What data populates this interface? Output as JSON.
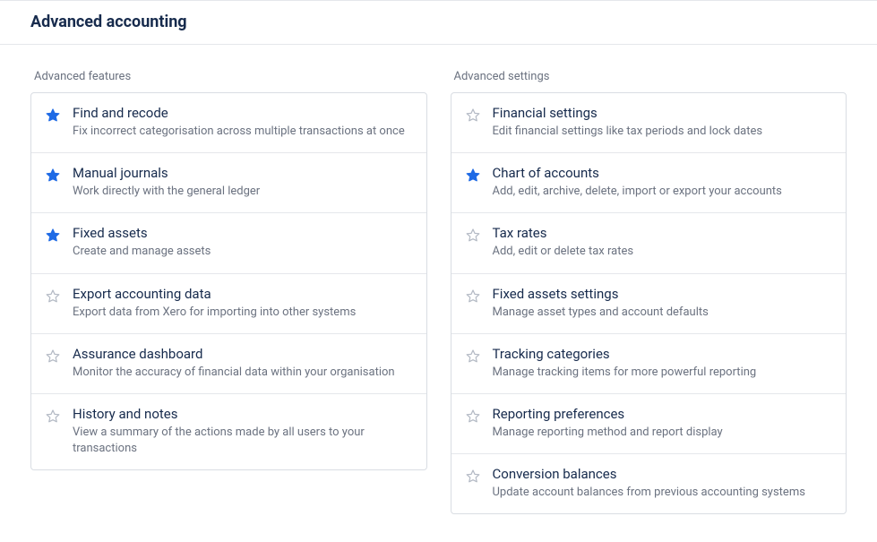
{
  "page_title": "Advanced accounting",
  "sections": {
    "features": {
      "label": "Advanced features",
      "items": [
        {
          "id": "find-and-recode",
          "starred": true,
          "title": "Find and recode",
          "desc": "Fix incorrect categorisation across multiple transactions at once"
        },
        {
          "id": "manual-journals",
          "starred": true,
          "title": "Manual journals",
          "desc": "Work directly with the general ledger"
        },
        {
          "id": "fixed-assets",
          "starred": true,
          "title": "Fixed assets",
          "desc": "Create and manage assets"
        },
        {
          "id": "export-accounting-data",
          "starred": false,
          "title": "Export accounting data",
          "desc": "Export data from Xero for importing into other systems"
        },
        {
          "id": "assurance-dashboard",
          "starred": false,
          "title": "Assurance dashboard",
          "desc": "Monitor the accuracy of financial data within your organisation"
        },
        {
          "id": "history-and-notes",
          "starred": false,
          "title": "History and notes",
          "desc": "View a summary of the actions made by all users to your transactions"
        }
      ]
    },
    "settings": {
      "label": "Advanced settings",
      "items": [
        {
          "id": "financial-settings",
          "starred": false,
          "title": "Financial settings",
          "desc": "Edit financial settings like tax periods and lock dates"
        },
        {
          "id": "chart-of-accounts",
          "starred": true,
          "title": "Chart of accounts",
          "desc": "Add, edit, archive, delete, import or export your accounts"
        },
        {
          "id": "tax-rates",
          "starred": false,
          "title": "Tax rates",
          "desc": "Add, edit or delete tax rates"
        },
        {
          "id": "fixed-assets-settings",
          "starred": false,
          "title": "Fixed assets settings",
          "desc": "Manage asset types and account defaults"
        },
        {
          "id": "tracking-categories",
          "starred": false,
          "title": "Tracking categories",
          "desc": "Manage tracking items for more powerful reporting"
        },
        {
          "id": "reporting-preferences",
          "starred": false,
          "title": "Reporting preferences",
          "desc": "Manage reporting method and report display"
        },
        {
          "id": "conversion-balances",
          "starred": false,
          "title": "Conversion balances",
          "desc": "Update account balances from previous accounting systems"
        }
      ]
    }
  }
}
